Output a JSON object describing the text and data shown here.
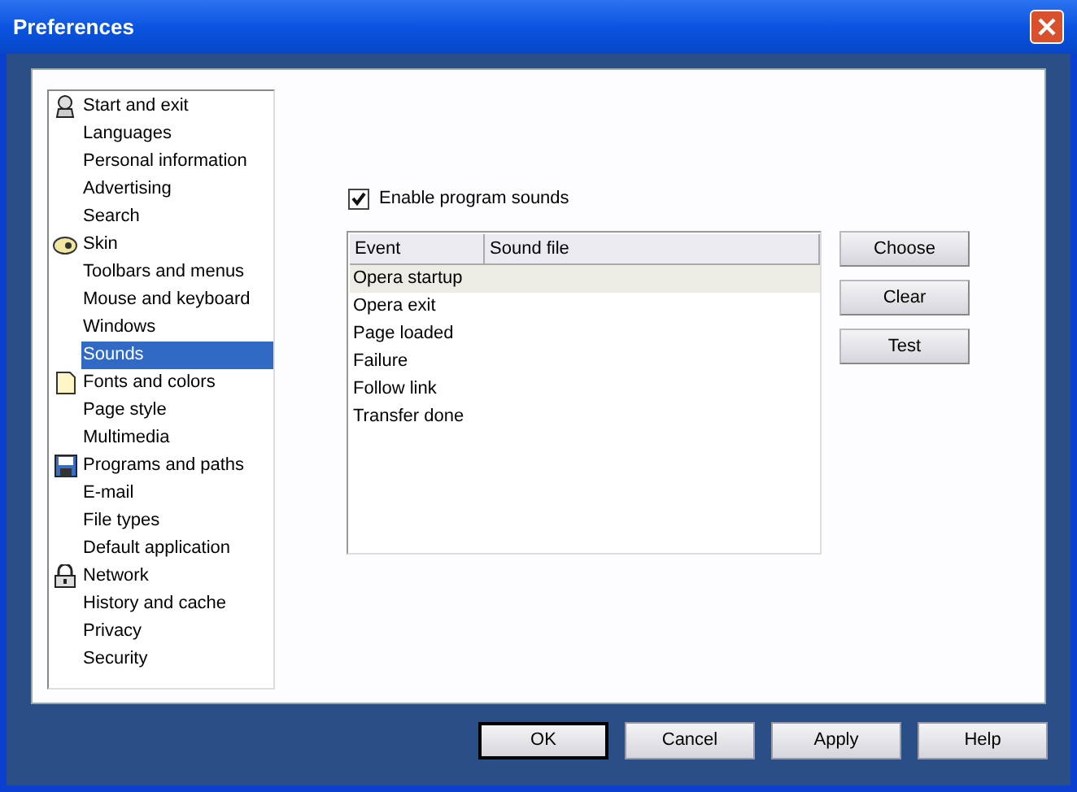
{
  "window": {
    "title": "Preferences"
  },
  "sidebar": {
    "items": [
      {
        "label": "Start and exit",
        "kind": "section",
        "selected": false
      },
      {
        "label": "Languages",
        "kind": "page",
        "selected": false
      },
      {
        "label": "Personal information",
        "kind": "page",
        "selected": false
      },
      {
        "label": "Advertising",
        "kind": "page",
        "selected": false
      },
      {
        "label": "Search",
        "kind": "page",
        "selected": false
      },
      {
        "label": "Skin",
        "kind": "section",
        "selected": false
      },
      {
        "label": "Toolbars and menus",
        "kind": "page",
        "selected": false
      },
      {
        "label": "Mouse and keyboard",
        "kind": "page",
        "selected": false
      },
      {
        "label": "Windows",
        "kind": "page",
        "selected": false
      },
      {
        "label": "Sounds",
        "kind": "page",
        "selected": true
      },
      {
        "label": "Fonts and colors",
        "kind": "section",
        "selected": false
      },
      {
        "label": "Page style",
        "kind": "page",
        "selected": false
      },
      {
        "label": "Multimedia",
        "kind": "page",
        "selected": false
      },
      {
        "label": "Programs and paths",
        "kind": "section",
        "selected": false
      },
      {
        "label": "E-mail",
        "kind": "page",
        "selected": false
      },
      {
        "label": "File types",
        "kind": "page",
        "selected": false
      },
      {
        "label": "Default application",
        "kind": "page",
        "selected": false
      },
      {
        "label": "Network",
        "kind": "section",
        "selected": false
      },
      {
        "label": "History and cache",
        "kind": "page",
        "selected": false
      },
      {
        "label": "Privacy",
        "kind": "page",
        "selected": false
      },
      {
        "label": "Security",
        "kind": "page",
        "selected": false
      }
    ]
  },
  "enable_sounds": {
    "label": "Enable program sounds",
    "checked": true
  },
  "table": {
    "columns": [
      "Event",
      "Sound file"
    ],
    "rows": [
      {
        "event": "Opera startup",
        "selected": true
      },
      {
        "event": "Opera exit",
        "selected": false
      },
      {
        "event": "Page loaded",
        "selected": false
      },
      {
        "event": "Failure",
        "selected": false
      },
      {
        "event": "Follow link",
        "selected": false
      },
      {
        "event": "Transfer done",
        "selected": false
      }
    ]
  },
  "side_buttons": [
    "Choose",
    "Clear",
    "Test"
  ],
  "buttons": [
    {
      "label": "OK",
      "default": true
    },
    {
      "label": "Cancel",
      "default": false
    },
    {
      "label": "Apply",
      "default": false
    },
    {
      "label": "Help",
      "default": false
    }
  ]
}
